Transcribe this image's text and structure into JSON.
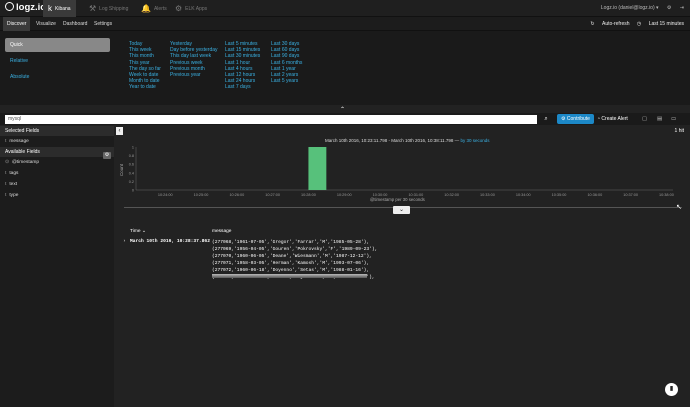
{
  "app": {
    "logo_text": "logz.io"
  },
  "app_tabs": [
    {
      "label": "Kibana",
      "icon": "k"
    },
    {
      "label": "Log Shipping",
      "icon": "⚒"
    },
    {
      "label": "Alerts",
      "icon": "🔔"
    },
    {
      "label": "ELK Apps",
      "icon": "⚙"
    }
  ],
  "user": {
    "email": "Logz.io (daniel@logz.io) ▾"
  },
  "nav": {
    "items": [
      "Discover",
      "Visualize",
      "Dashboard",
      "Settings"
    ]
  },
  "timebar": {
    "auto_refresh": "Auto-refresh",
    "range": "Last 15 minutes"
  },
  "timepicker": {
    "modes": [
      "Quick",
      "Relative",
      "Absolute"
    ],
    "columns": [
      [
        "Today",
        "This week",
        "This month",
        "This year",
        "The day so far",
        "Week to date",
        "Month to date",
        "Year to date"
      ],
      [
        "Yesterday",
        "Day before yesterday",
        "This day last week",
        "Previous week",
        "Previous month",
        "Previous year"
      ],
      [
        "Last 5 minutes",
        "Last 15 minutes",
        "Last 30 minutes",
        "Last 1 hour",
        "Last 4 hours",
        "Last 12 hours",
        "Last 24 hours",
        "Last 7 days"
      ],
      [
        "Last 30 days",
        "Last 60 days",
        "Last 90 days",
        "Last 6 months",
        "Last 1 year",
        "Last 2 years",
        "Last 5 years"
      ]
    ]
  },
  "query": {
    "value": "mysql"
  },
  "toolbar": {
    "contribute": "Contribute",
    "create_alert": "Create Alert"
  },
  "sidebar": {
    "selected_title": "Selected Fields",
    "selected": [
      {
        "type": "t",
        "name": "message"
      }
    ],
    "available_title": "Available Fields",
    "available": [
      {
        "type": "⊙",
        "name": "@timestamp"
      },
      {
        "type": "t",
        "name": "tags"
      },
      {
        "type": "t",
        "name": "text"
      },
      {
        "type": "t",
        "name": "type"
      }
    ]
  },
  "histogram": {
    "range_text": "March 10th 2016, 10:23:11.798 - March 10th 2016, 10:38:11.798 —",
    "interval_link": "by 30 seconds",
    "hits": "1 hit",
    "xlabel": "@timestamp per 30 seconds"
  },
  "chart_data": {
    "type": "bar",
    "ylabel": "Count",
    "yticks": [
      "1",
      "0.8",
      "0.6",
      "0.4",
      "0.2",
      "0"
    ],
    "ylim": [
      0,
      1
    ],
    "categories": [
      "10:24:00",
      "10:25:00",
      "10:26:00",
      "10:27:00",
      "10:28:00",
      "10:29:00",
      "10:30:00",
      "10:31:00",
      "10:32:00",
      "10:33:00",
      "10:34:00",
      "10:35:00",
      "10:36:00",
      "10:37:00",
      "10:38:00"
    ],
    "bars": [
      {
        "x": "10:28:30",
        "value": 1
      }
    ],
    "bar_color": "#57c17b"
  },
  "docs": {
    "columns": [
      "Time",
      "message"
    ],
    "rows": [
      {
        "time": "March 10th 2016, 10:28:37.862",
        "lines": [
          "(277068,'1961-07-05','Gregor','Farrar','M','1985-05-28'),",
          "(277069,'1956-04-05','Gouren','Pokrovsky','F','1989-09-23'),",
          "(277070,'1960-06-05','Deane','Wiesmann','M','1987-12-12'),",
          "(277071,'1958-03-05','Herman','Kamosh','M','1993-07-06'),",
          "(277072,'1960-06-18','Doyenno','Setas','M','1988-01-16'),",
          "(277073,'1959-07-04','Oumin','Kujaroman','M','1992-01-31'),"
        ]
      }
    ]
  }
}
